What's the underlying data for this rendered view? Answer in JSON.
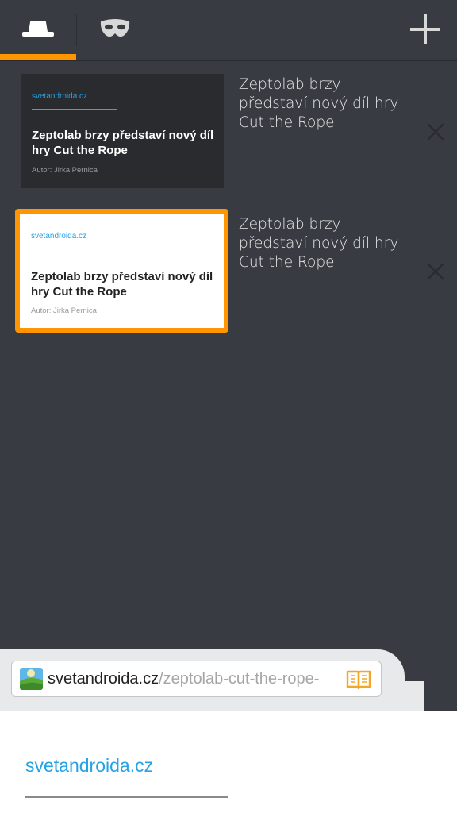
{
  "top_bar": {
    "tabs": [
      {
        "icon": "hat-icon",
        "label": "",
        "selected": true
      },
      {
        "icon": "mask-icon",
        "label": ""
      }
    ],
    "add_icon": "plus-icon",
    "accent_color": "#ff9500"
  },
  "tabs": [
    {
      "thumbnail_site": "svetandroida.cz",
      "thumbnail_headline": "Zeptolab brzy představí nový díl hry Cut the Rope",
      "thumbnail_author": "Autor: Jirka Pernica",
      "title": "Zeptolab brzy představí nový díl hry Cut the Rope",
      "theme": "dark",
      "selected": false
    },
    {
      "thumbnail_site": "svetandroida.cz",
      "thumbnail_headline": "Zeptolab brzy představí nový díl hry Cut the Rope",
      "thumbnail_author": "Autor: Jirka Pernica",
      "title": "Zeptolab brzy představí nový díl hry Cut the Rope",
      "theme": "light",
      "selected": true
    }
  ],
  "url_bar": {
    "domain": "svetandroida.cz",
    "path": "/zeptolab-cut-the-rope-",
    "reader_icon": "reader-mode-icon"
  },
  "page": {
    "site_name": "svetandroida.cz"
  }
}
